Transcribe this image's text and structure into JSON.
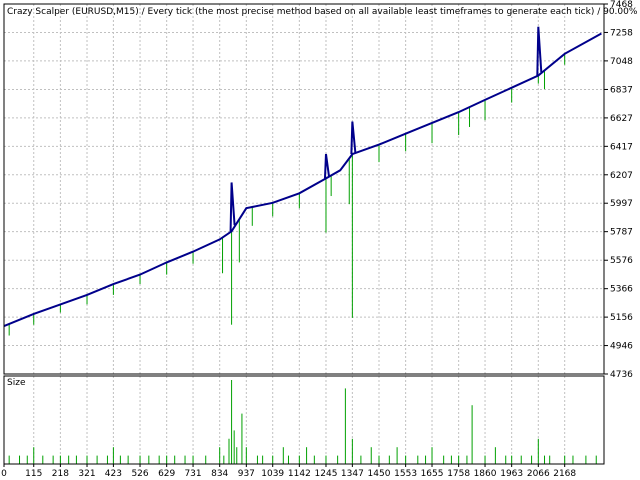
{
  "chart_data": [
    {
      "type": "line",
      "title": "Crazy Scalper (EURUSD,M15) / Every tick (the most precise method based on all available least timeframes to generate each tick) / 90.00%",
      "xlabel": "",
      "ylabel": "",
      "y_ticks": [
        4736,
        4946,
        5156,
        5366,
        5576,
        5787,
        5997,
        6207,
        6417,
        6627,
        6837,
        7048,
        7258,
        7468
      ],
      "ylim": [
        4736,
        7468
      ],
      "xlim": [
        0,
        2320
      ],
      "grid": true,
      "colors": {
        "balance": "#00008b",
        "equity": "#00a000",
        "grid": "#c0c0c0",
        "frame": "#000000"
      },
      "series": [
        {
          "role": "balance",
          "x": [
            0,
            115,
            218,
            321,
            423,
            526,
            629,
            731,
            834,
            880,
            937,
            1039,
            1142,
            1245,
            1300,
            1347,
            1450,
            1553,
            1655,
            1758,
            1860,
            1963,
            2066,
            2168,
            2310
          ],
          "values": [
            5090,
            5180,
            5250,
            5320,
            5400,
            5470,
            5560,
            5640,
            5730,
            5790,
            5960,
            6000,
            6070,
            6180,
            6240,
            6360,
            6430,
            6510,
            6590,
            6670,
            6760,
            6850,
            6940,
            7100,
            7250
          ]
        },
        {
          "role": "balance_spikes",
          "x": [
            880,
            1245,
            1347,
            2066
          ],
          "values": [
            6150,
            6360,
            6600,
            7300
          ]
        },
        {
          "role": "equity_drawdowns",
          "x": [
            20,
            115,
            218,
            321,
            423,
            526,
            629,
            731,
            845,
            880,
            910,
            960,
            1039,
            1142,
            1245,
            1265,
            1335,
            1347,
            1450,
            1553,
            1655,
            1758,
            1800,
            1860,
            1963,
            2066,
            2090,
            2168
          ],
          "values": [
            5020,
            5100,
            5190,
            5250,
            5320,
            5400,
            5470,
            5550,
            5480,
            5100,
            5560,
            5830,
            5900,
            5960,
            5780,
            6050,
            5990,
            5150,
            6300,
            6380,
            6440,
            6500,
            6560,
            6610,
            6740,
            6880,
            6840,
            7020
          ]
        }
      ]
    },
    {
      "type": "bar",
      "title": "Size",
      "xlabel": "",
      "ylabel": "",
      "x_ticks": [
        0,
        115,
        218,
        321,
        423,
        526,
        629,
        731,
        834,
        937,
        1039,
        1142,
        1245,
        1347,
        1450,
        1553,
        1655,
        1758,
        1860,
        1963,
        2066,
        2168
      ],
      "xlim": [
        0,
        2320
      ],
      "ylim": [
        0,
        10
      ],
      "colors": {
        "bars": "#00a000"
      },
      "x": [
        20,
        60,
        90,
        115,
        150,
        190,
        218,
        250,
        280,
        321,
        360,
        400,
        423,
        450,
        480,
        526,
        560,
        600,
        629,
        660,
        700,
        731,
        780,
        834,
        850,
        870,
        880,
        890,
        900,
        920,
        937,
        980,
        1000,
        1039,
        1080,
        1100,
        1142,
        1170,
        1200,
        1245,
        1290,
        1320,
        1347,
        1380,
        1420,
        1450,
        1490,
        1520,
        1553,
        1600,
        1630,
        1655,
        1700,
        1730,
        1758,
        1790,
        1810,
        1860,
        1900,
        1940,
        1963,
        2000,
        2040,
        2066,
        2090,
        2110,
        2168,
        2200,
        2250,
        2290
      ],
      "values": [
        1,
        1,
        1,
        2,
        1,
        1,
        1,
        1,
        1,
        1,
        1,
        1,
        2,
        1,
        1,
        1,
        1,
        1,
        1,
        1,
        1,
        1,
        1,
        2,
        1,
        3,
        10,
        4,
        2,
        6,
        2,
        1,
        1,
        1,
        2,
        1,
        1,
        2,
        1,
        1,
        1,
        9,
        3,
        1,
        2,
        1,
        1,
        2,
        1,
        1,
        1,
        2,
        1,
        1,
        1,
        1,
        7,
        1,
        2,
        1,
        1,
        1,
        1,
        3,
        1,
        1,
        1,
        1,
        1,
        1
      ]
    }
  ]
}
